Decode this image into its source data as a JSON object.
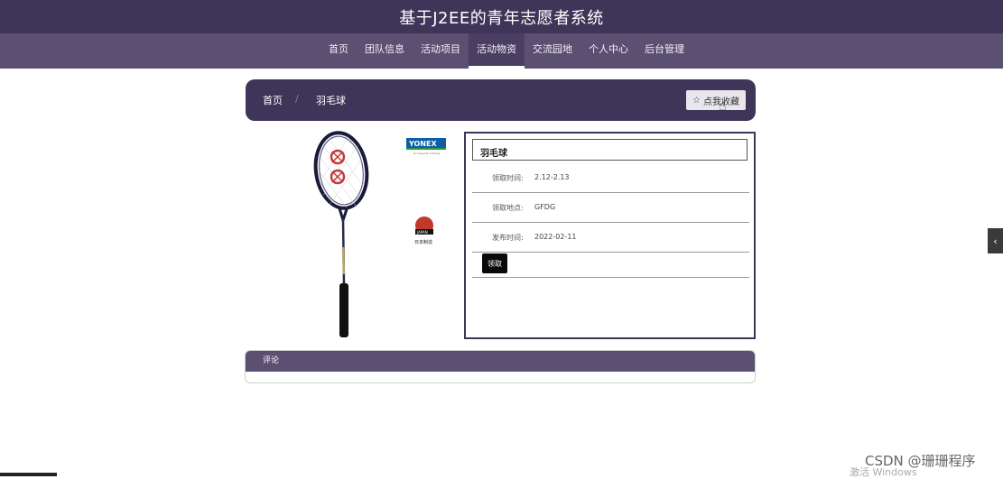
{
  "header": {
    "title": "基于J2EE的青年志愿者系统"
  },
  "nav": {
    "items": [
      {
        "label": "首页"
      },
      {
        "label": "团队信息"
      },
      {
        "label": "活动项目"
      },
      {
        "label": "活动物资"
      },
      {
        "label": "交流园地"
      },
      {
        "label": "个人中心"
      },
      {
        "label": "后台管理"
      }
    ],
    "active": "活动物资"
  },
  "breadcrumb": {
    "home": "首页",
    "separator": "/",
    "current": "羽毛球"
  },
  "favorite": {
    "icon": "star-outline-icon",
    "label": "点我收藏"
  },
  "product": {
    "image_brand": "YONEX",
    "image_tagline": "for beyond ordinary",
    "image_origin_badge": "JAPAN",
    "image_origin": "日本制造"
  },
  "detail": {
    "title": "羽毛球",
    "rows": [
      {
        "label": "领取时间:",
        "value": "2.12-2.13"
      },
      {
        "label": "领取地点:",
        "value": "GFDG"
      },
      {
        "label": "发布时间:",
        "value": "2022-02-11"
      }
    ],
    "claim_button": "领取"
  },
  "comments": {
    "title": "评论"
  },
  "side_tab": {
    "icon": "chevron-left-icon",
    "glyph": "‹"
  },
  "overlay": {
    "watermark": "CSDN @珊珊程序",
    "activate": "激活 Windows"
  },
  "colors": {
    "primary": "#3f3558",
    "nav": "#5b4f72",
    "button": "#0a0a0a"
  }
}
